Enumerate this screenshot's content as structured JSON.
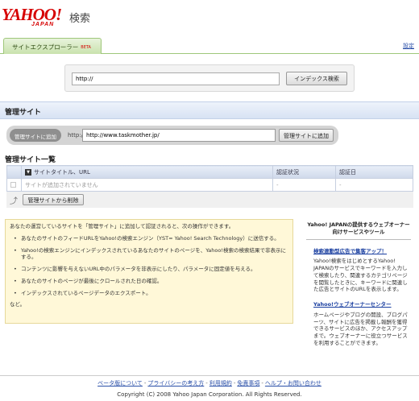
{
  "header": {
    "logo_text": "YAHOO!",
    "logo_sub": "JAPAN",
    "logo_suffix": "検索"
  },
  "nav": {
    "tab_label": "サイトエクスプローラー",
    "tab_badge": "BETA",
    "settings_link": "設定"
  },
  "search": {
    "value": "http://",
    "button_label": "インデックス検索"
  },
  "managed": {
    "section_title": "管理サイト",
    "add_label": "管理サイトに追加",
    "prefix": "http://",
    "add_value": "http://www.taskmother.jp/",
    "add_button": "管理サイトに追加"
  },
  "site_list": {
    "title": "管理サイト一覧",
    "columns": [
      "サイトタイトル、URL",
      "認証状況",
      "認証日"
    ],
    "sort_icon": "▼",
    "empty_message": "サイトが追加されていません",
    "empty_status": "-",
    "empty_date": "-",
    "up_icon": "arrow-up-icon",
    "remove_button": "管理サイトから削除"
  },
  "info": {
    "intro": "あなたの運営しているサイトを「管理サイト」に追加して認証されると、次の操作ができます。",
    "items": [
      "あなたのサイトのフィードURLをYahoo!の検索エンジン（YST= Yahoo! Search Technology）に送信する。",
      "Yahoo!の検索エンジンにインデックスされているあなたのサイトのページを、Yahoo!検索の検索結果で非表示にする。",
      "コンテンツに影響を与えないURL中のパラメータを非表示にしたり、パラメータに固定値を与える。",
      "あなたのサイトのページが最後にクロールされた日の確認。",
      "インデックスされているページデータのエクスポート。"
    ],
    "etc": "など。"
  },
  "sidebar": {
    "title": "Yahoo! JAPANの提供するウェブオーナー向けサービスやツール",
    "sections": [
      {
        "link": "検索連動型広告で集客アップ！",
        "text": "Yahoo!検索をはじめとするYahoo! JAPANのサービスでキーワードを入力して検索したり、関連するカテゴリページを閲覧したときに、キーワードに関連した広告とサイトのURLを表示します。"
      },
      {
        "link": "Yahoo!ウェブオーナーセンター",
        "text": "ホームページやブログの開設、ブログパーツ、サイトに広告を掲載し報酬を獲得できるサービスのほか、アクセスアップまで。ウェブオーナーに役立つサービスを利用することができます。"
      }
    ]
  },
  "footer": {
    "links": [
      "ベータ版について",
      "プライバシーの考え方",
      "利用規約",
      "免責事項",
      "ヘルプ・お問い合わせ"
    ],
    "separator": "-",
    "copyright": "Copyright (C) 2008 Yahoo Japan Corporation. All Rights Reserved."
  }
}
